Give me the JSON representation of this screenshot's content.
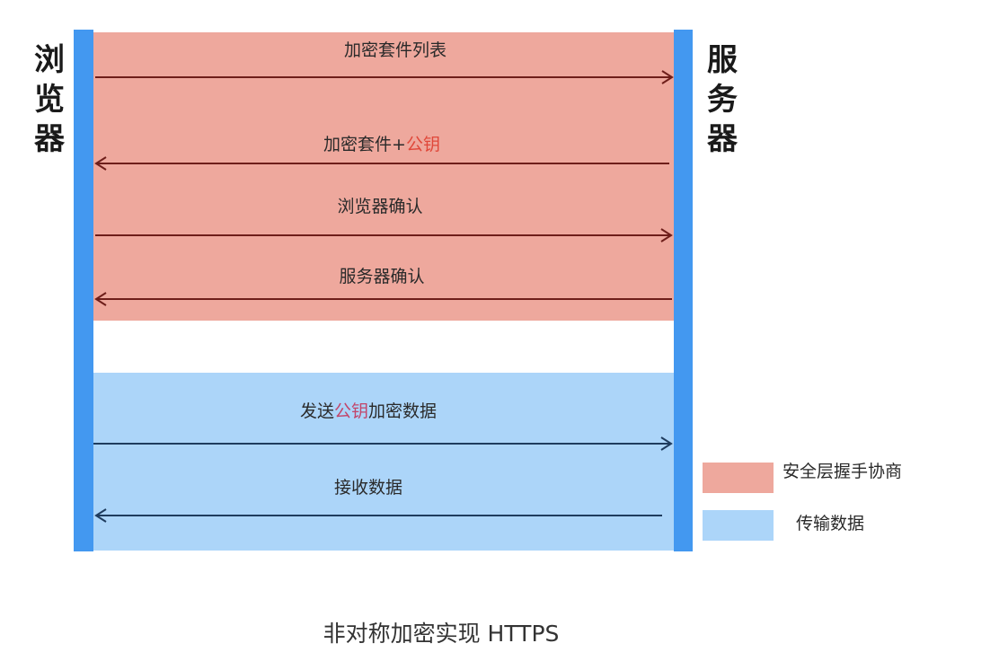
{
  "diagram": {
    "actors": {
      "left": [
        "浏",
        "览",
        "器"
      ],
      "right": [
        "服",
        "务",
        "器"
      ]
    },
    "messages": [
      {
        "direction": "right",
        "phase": "handshake",
        "parts": [
          {
            "text": "加密套件列表",
            "style": "normal"
          }
        ]
      },
      {
        "direction": "left",
        "phase": "handshake",
        "parts": [
          {
            "text": "加密套件+",
            "style": "normal"
          },
          {
            "text": "公钥",
            "style": "red"
          }
        ]
      },
      {
        "direction": "right",
        "phase": "handshake",
        "parts": [
          {
            "text": "浏览器确认",
            "style": "normal"
          }
        ]
      },
      {
        "direction": "left",
        "phase": "handshake",
        "parts": [
          {
            "text": "服务器确认",
            "style": "normal"
          }
        ]
      },
      {
        "direction": "right",
        "phase": "transfer",
        "parts": [
          {
            "text": "发送",
            "style": "normal"
          },
          {
            "text": "公钥",
            "style": "pink"
          },
          {
            "text": "加密数据",
            "style": "normal"
          }
        ]
      },
      {
        "direction": "left",
        "phase": "transfer",
        "parts": [
          {
            "text": "接收数据",
            "style": "normal"
          }
        ]
      }
    ],
    "legend": [
      {
        "label": "安全层握手协商",
        "color": "#eea89d"
      },
      {
        "label": "传输数据",
        "color": "#acd5f9"
      }
    ],
    "colors": {
      "lifeline": "#4398f0",
      "handshake_bg": "#eea89d",
      "transfer_bg": "#acd5f9",
      "handshake_arrow": "#6e1e1a",
      "transfer_arrow": "#1f3c5e",
      "highlight_red": "#e0483a",
      "highlight_pink": "#c2456a"
    }
  },
  "caption": "非对称加密实现 HTTPS"
}
